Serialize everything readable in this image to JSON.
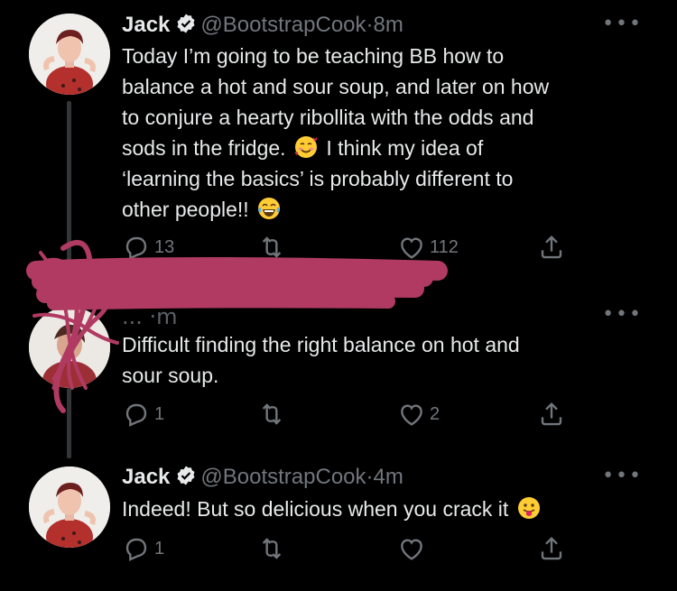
{
  "tweets": [
    {
      "name": "Jack",
      "handle": "@BootstrapCook",
      "separator": "·",
      "time": "8m",
      "lines": [
        "Today I’m going to be teaching BB how to",
        "balance a hot and sour soup, and later on how",
        "to conjure a hearty ribollita with the odds and",
        "sods in the fridge.",
        "I think my idea of",
        "‘learning the basics’ is probably different to",
        "other people!!"
      ],
      "reply_count": "13",
      "retweet_count": "",
      "like_count": "112"
    },
    {
      "header_obscured": "... ·m",
      "lines": [
        "Difficult finding the right balance on hot and",
        "sour soup."
      ],
      "reply_count": "1",
      "retweet_count": "",
      "like_count": "2"
    },
    {
      "name": "Jack",
      "handle": "@BootstrapCook",
      "separator": "·",
      "time": "4m",
      "text": "Indeed! But so delicious when you crack it",
      "reply_count": "1",
      "retweet_count": "",
      "like_count": ""
    }
  ],
  "icons": {
    "verified": "verified-badge-icon",
    "reply": "reply-icon",
    "retweet": "retweet-icon",
    "like": "heart-icon",
    "share": "share-icon",
    "more": "more-dots-icon",
    "emoji1": "smiling-face-with-hearts-emoji",
    "emoji2": "tears-of-joy-emoji",
    "emoji3": "face-with-tongue-emoji"
  },
  "colors": {
    "background": "#000000",
    "text": "#e7e9ea",
    "secondary": "#71767b",
    "scribble": "#b03a62"
  }
}
